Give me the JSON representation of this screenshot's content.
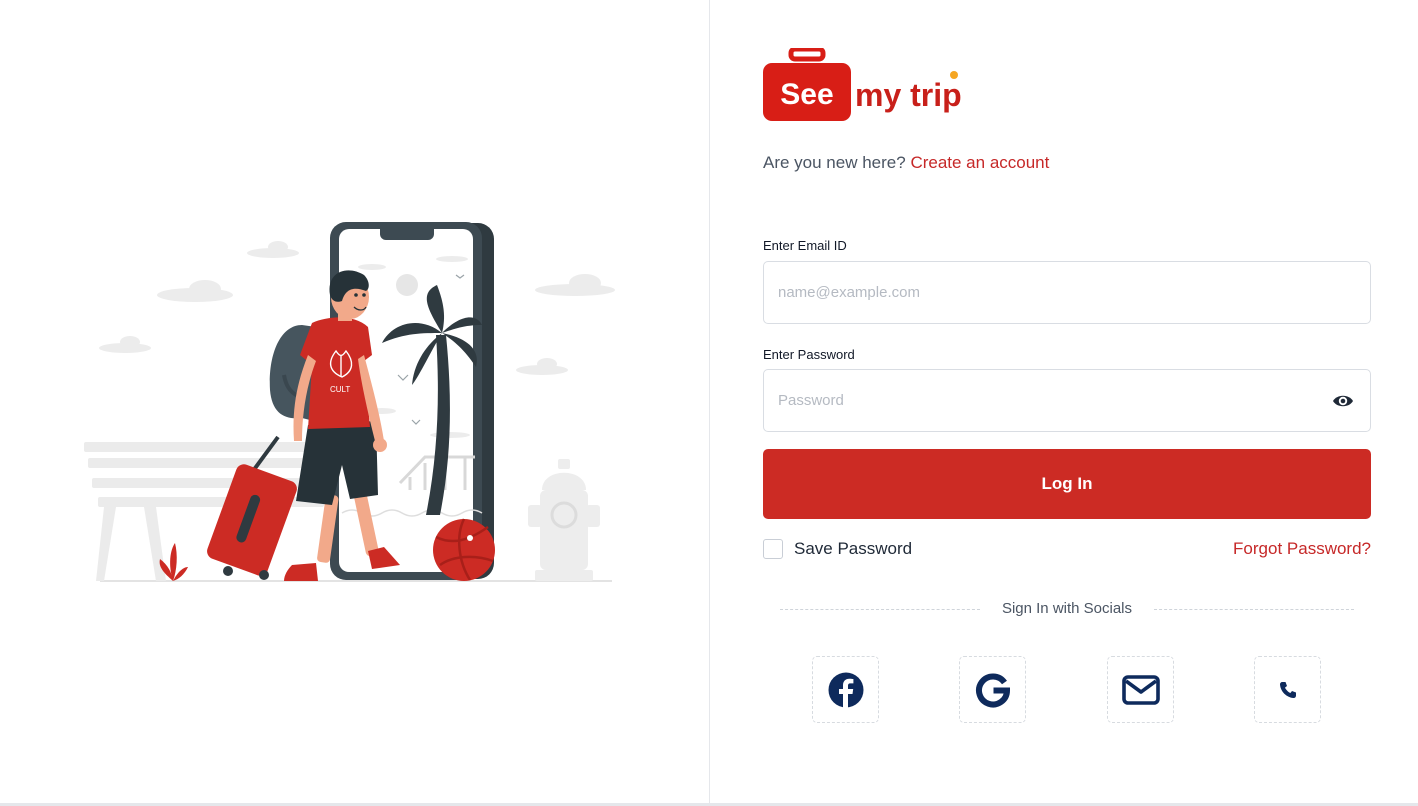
{
  "brand": {
    "logo_see": "See",
    "logo_mytrip": "my trip",
    "accent_color": "#cc2b24"
  },
  "signup_prompt": {
    "text": "Are you new here?",
    "link": "Create an account"
  },
  "form": {
    "email_label": "Enter Email ID",
    "email_placeholder": "name@example.com",
    "email_value": "",
    "password_label": "Enter Password",
    "password_placeholder": "Password",
    "password_value": "",
    "login_label": "Log In",
    "save_password_label": "Save Password",
    "save_password_checked": false,
    "forgot_label": "Forgot Password?"
  },
  "socials": {
    "heading": "Sign In with Socials",
    "buttons": [
      {
        "icon": "facebook-icon"
      },
      {
        "icon": "google-icon"
      },
      {
        "icon": "mail-icon"
      },
      {
        "icon": "phone-icon"
      }
    ]
  },
  "illustration": {
    "shirt_text": "CULT"
  }
}
